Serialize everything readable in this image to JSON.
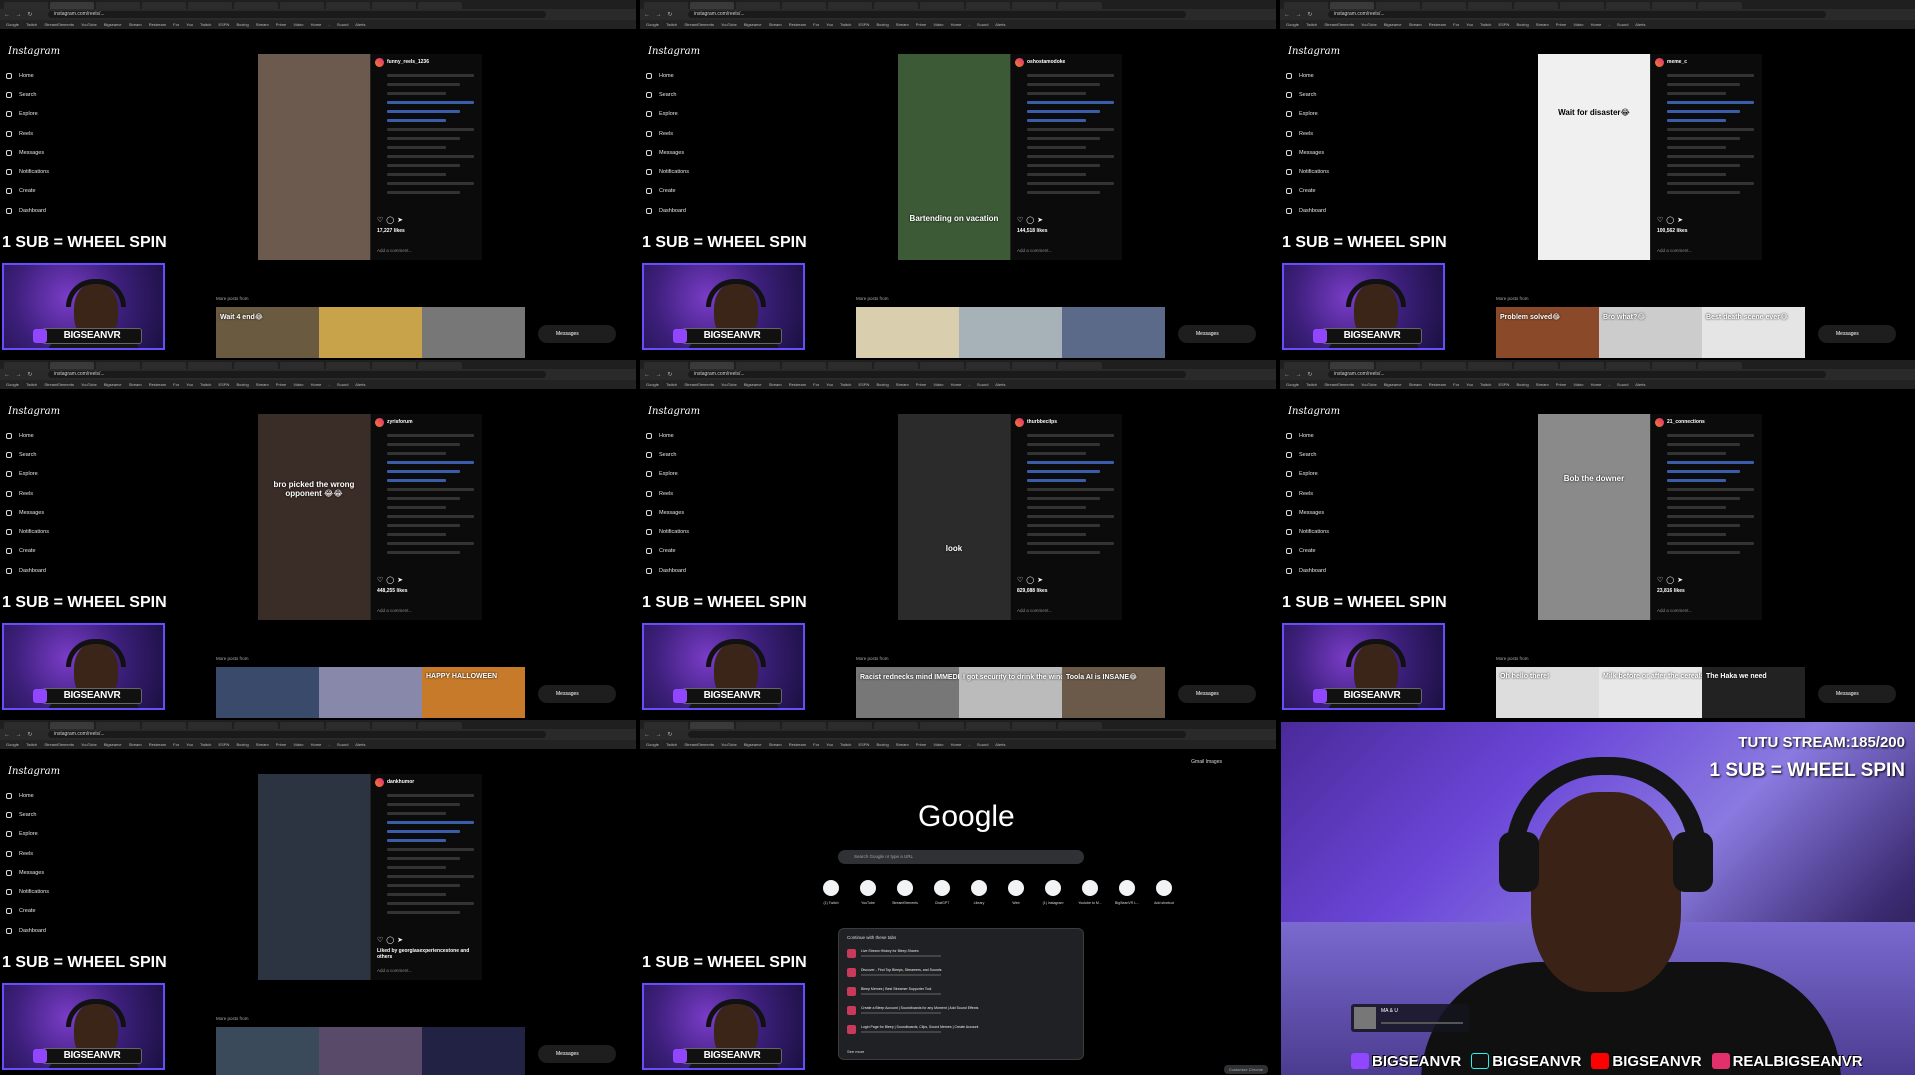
{
  "browser": {
    "url_instagram": "instagram.com/reels/...",
    "bookmarks": "Google Twitch StreamElements YouTube Bigseanvr Stream Restream For You Twitch ESPN Boxing Stream Prime Video Home - Sound Alerts",
    "nav_glyphs": "← → ↻"
  },
  "instagram": {
    "logo": "Instagram",
    "nav": [
      "Home",
      "Search",
      "Explore",
      "Reels",
      "Messages",
      "Notifications",
      "Create",
      "Dashboard"
    ],
    "messages_label": "Messages",
    "add_comment": "Add a comment...",
    "more_posts_prefix": "More posts from"
  },
  "tiles": [
    {
      "user": "funny_reels_1236",
      "likes": "17,227 likes",
      "caption": "",
      "thumbs": [
        "Wait 4 end😂",
        "",
        ""
      ]
    },
    {
      "user": "oshostamodoke",
      "likes": "144,518 likes",
      "caption": "Bartending on vacation",
      "thumbs": [
        "",
        "",
        ""
      ]
    },
    {
      "user": "meme_c",
      "likes": "100,562 likes",
      "caption": "Wait for disaster😂",
      "thumbs": [
        "Problem solved😂",
        "Bro what?😂",
        "Best death scene ever😂"
      ]
    },
    {
      "user": "zyrisforum",
      "likes": "448,255 likes",
      "caption": "bro picked the wrong opponent 😂😂",
      "thumbs": [
        "",
        "",
        "HAPPY HALLOWEEN"
      ]
    },
    {
      "user": "thurbbecilps",
      "likes": "829,088 likes",
      "caption": "look",
      "thumbs": [
        "Racist rednecks mind IMMEDIATELY went to that conclusion 💀",
        "I got security to drink the window 😭😭",
        "Toola AI is INSANE😂"
      ]
    },
    {
      "user": "21_connections",
      "likes": "23,816 likes",
      "caption": "Bob the downer",
      "thumbs": [
        "Oh hello there!",
        "Milk before or after the cereals Me :",
        "The Haka we need"
      ]
    },
    {
      "user": "dankhumor",
      "likes": "Liked by georgiasexperiencestone and others",
      "caption": "",
      "thumbs": [
        "",
        "",
        ""
      ]
    }
  ],
  "overlay": {
    "wheel": "1 SUB = WHEEL SPIN",
    "cam_tag": "BIGSEANVR"
  },
  "google": {
    "logo": "Google",
    "search_placeholder": "Search Google or type a URL",
    "top_links": "Gmail  Images",
    "shortcuts": [
      "(1) Twitch",
      "YouTube",
      "StreamElements",
      "ChatGPT",
      "Library",
      "Web",
      "(1) Instagram",
      "Youtube to M...",
      "BigSeanVR L...",
      "Add shortcut"
    ],
    "card_title": "Continue with these tabs",
    "card_rows": [
      "Live Stream History for Bleep Shares",
      "Discover - Find Top Bleeps, Streamers, and Sounds",
      "Bleep Memes | Best Streamer Supporter Tool",
      "Create a Bleep Account | Soundboards for any Moment | Add Sound Effects",
      "Login Page for Bleep | Soundboards, Clips, Sound Memes | Create Account"
    ],
    "see_more": "See more",
    "customize": "Customize Chrome"
  },
  "main_cam": {
    "counter": "TUTU STREAM:185/200",
    "wheel": "1 SUB = WHEEL SPIN",
    "now_playing": "MA & U",
    "socials": [
      {
        "label": "BIGSEANVR",
        "color": "#9146ff",
        "icon": "twitch-icon"
      },
      {
        "label": "BIGSEANVR",
        "color": "#111111",
        "icon": "tiktok-icon"
      },
      {
        "label": "BIGSEANVR",
        "color": "#ff0000",
        "icon": "youtube-icon"
      },
      {
        "label": "REALBIGSEANVR",
        "color": "#e1306c",
        "icon": "instagram-icon"
      }
    ]
  }
}
